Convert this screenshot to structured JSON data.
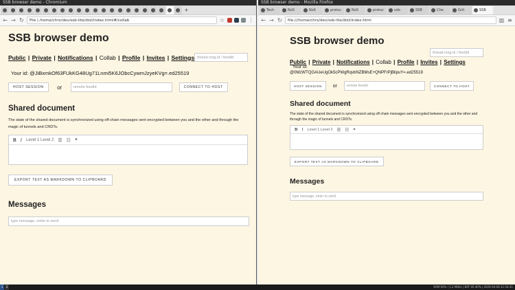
{
  "left": {
    "window_title": "SSB browser demo - Chromium",
    "tabs": [
      "",
      "",
      "",
      "",
      "",
      "",
      "",
      "",
      "",
      "",
      "",
      "",
      "",
      "",
      "",
      "",
      "",
      "",
      "",
      "",
      "",
      ""
    ],
    "url": "File | /home/chrx/dev/ssb-lite/dist/index.html#/collab",
    "page_title": "SSB browser demo",
    "nav": {
      "public": "Public",
      "private": "Private",
      "notifications": "Notifications",
      "collab": "Collab",
      "profile": "Profile",
      "invites": "Invites",
      "settings": "Settings"
    },
    "thread_placeholder": "thread msg id / feedId",
    "your_id": "Your id: @JiBxmkOf63FUkKG48Ug71Lnmi5K6JObcCywmJzyeKVg=.ed25519",
    "host_session": "HOST SESSION",
    "or": "or",
    "remote_placeholder": "remote feedId",
    "connect_to_host": "CONNECT TO HOST",
    "shared_heading": "Shared document",
    "shared_desc": "The state of the shared document is synchronized using off-chain messages sent encrypted between you and the other and through the magic of tunnels and CRDTs.",
    "toolbar": {
      "bold": "B",
      "italic": "I",
      "levels": "Level 1 Level 2",
      "bullets": "☰",
      "ordered": "☷",
      "quote": "❝"
    },
    "export_button": "EXPORT TEXT AS MARKDOWN TO CLIPBOARD",
    "messages_heading": "Messages",
    "message_placeholder": "type message, enter to send"
  },
  "right": {
    "window_title": "SSB browser demo - Mozilla Firefox",
    "tabs": [
      "Tech",
      "NoS",
      "NoS",
      "protoc",
      "NoS",
      "protoc",
      "ssb-",
      "SSB",
      "Che",
      "Grit",
      "SSB"
    ],
    "url": "file:///home/chrx/dev/ssb-lite/dist/index.html",
    "page_title": "SSB browser demo",
    "thread_placeholder": "thread msg id / feedId",
    "your_id_label": "Your id:",
    "your_id": "@0MzWTQGAUeUgOk5cPWgRqvbNZBMsE+QNPFrPjBlipuY=.ed25519",
    "shared_desc": "The state of the shared document is synchronized using off-chain messages sent encrypted between you and the other and through the magic of tunnels and CRDTs.",
    "message_placeholder": "type message, enter to send"
  },
  "taskbar": {
    "workspaces": [
      "1",
      "2"
    ],
    "status": "RAM 92% | 1.2 MiB/s | BAT 95.40% | 2020-04-06 21:54:31"
  }
}
